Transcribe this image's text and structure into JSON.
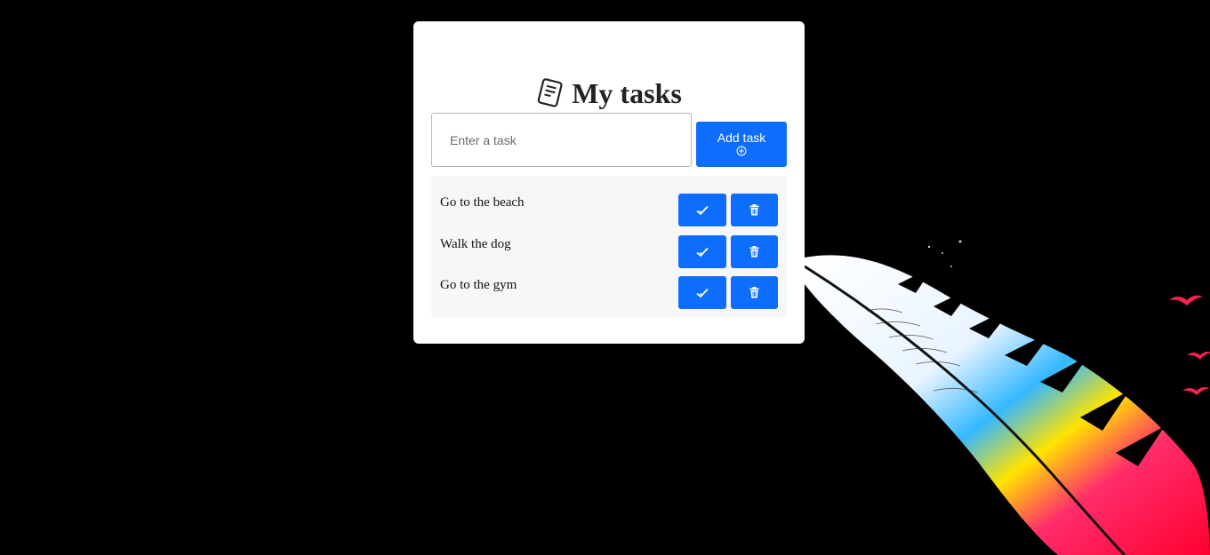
{
  "title": "My tasks",
  "title_icon": "notepad-icon",
  "input": {
    "placeholder": "Enter a task",
    "value": ""
  },
  "add_button": {
    "label": "Add task",
    "icon": "plus-circle-icon"
  },
  "tasks": [
    {
      "text": "Go to the beach"
    },
    {
      "text": "Walk the dog"
    },
    {
      "text": "Go to the gym"
    }
  ],
  "task_actions": {
    "complete_icon": "check-icon",
    "delete_icon": "trash-icon"
  },
  "colors": {
    "background": "#000000",
    "card": "#ffffff",
    "accent": "#0d6efd",
    "list_bg": "#f7f7f7"
  }
}
